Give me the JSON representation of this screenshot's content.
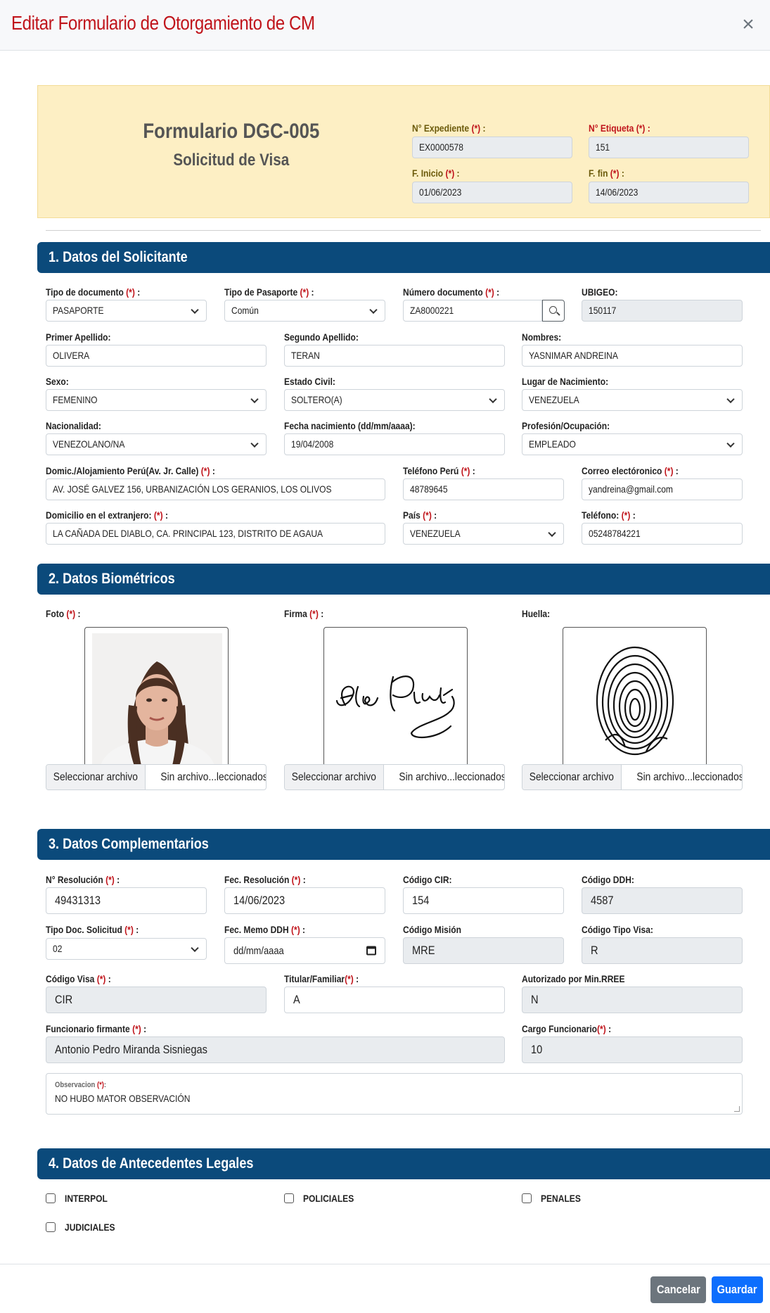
{
  "modal": {
    "title": "Editar Formulario de Otorgamiento de CM",
    "close_icon": "close-icon"
  },
  "header_box": {
    "title": "Formulario DGC-005",
    "subtitle": "Solicitud de Visa",
    "expediente_label": "N° Expediente",
    "expediente_value": "EX0000578",
    "etiqueta_label": "N° Etiqueta",
    "etiqueta_value": "151",
    "inicio_label": "F. Inicio",
    "inicio_value": "01/06/2023",
    "fin_label": "F. fin",
    "fin_value": "14/06/2023"
  },
  "req_mark": "(*)",
  "colon": ":",
  "section1": {
    "title": "1. Datos del Solicitante",
    "tipo_doc_label": "Tipo de documento",
    "tipo_doc_value": "PASAPORTE",
    "tipo_pas_label": "Tipo de Pasaporte",
    "tipo_pas_value": "Común",
    "num_doc_label": "Número documento",
    "num_doc_value": "ZA8000221",
    "ubigeo_label": "UBIGEO:",
    "ubigeo_value": "150117",
    "ap1_label": "Primer Apellido:",
    "ap1_value": "OLIVERA",
    "ap2_label": "Segundo Apellido:",
    "ap2_value": "TERAN",
    "nombres_label": "Nombres:",
    "nombres_value": "YASNIMAR ANDREINA",
    "sexo_label": "Sexo:",
    "sexo_value": "FEMENINO",
    "civil_label": "Estado Civil:",
    "civil_value": "SOLTERO(A)",
    "lugar_label": "Lugar de Nacimiento:",
    "lugar_value": "VENEZUELA",
    "nac_label": "Nacionalidad:",
    "nac_value": "VENEZOLANO/NA",
    "fnac_label": "Fecha nacimiento (dd/mm/aaaa):",
    "fnac_value": "19/04/2008",
    "prof_label": "Profesión/Ocupación:",
    "prof_value": "EMPLEADO",
    "domic_label": "Domic./Alojamiento Perú(Av. Jr. Calle)",
    "domic_value": "AV. JOSÉ GALVEZ 156, URBANIZACIÓN LOS GERANIOS, LOS OLIVOS",
    "tel_peru_label": "Teléfono Perú",
    "tel_peru_value": "48789645",
    "correo_label": "Correo electóronico",
    "correo_value": "yandreina@gmail.com",
    "domic_ext_label": "Domicilio en el extranjero:",
    "domic_ext_value": "LA CAÑADA DEL DIABLO, CA. PRINCIPAL 123, DISTRITO DE AGAUA",
    "pais_label": "País",
    "pais_value": "VENEZUELA",
    "tel_label": "Teléfono:",
    "tel_value": "05248784221"
  },
  "section2": {
    "title": "2. Datos Biométricos",
    "foto_label": "Foto",
    "firma_label": "Firma",
    "huella_label": "Huella:",
    "file_button": "Seleccionar archivo",
    "file_none": "Sin archivo...leccionados"
  },
  "section3": {
    "title": "3. Datos Complementarios",
    "resol_label": "N° Resolución",
    "resol_value": "49431313",
    "fresol_label": "Fec. Resolución",
    "fresol_value": "14/06/2023",
    "cir_label": "Código CIR:",
    "cir_value": "154",
    "ddh_label": "Código DDH:",
    "ddh_value": "4587",
    "tipodoc_label": "Tipo Doc. Solicitud",
    "tipodoc_value": "02",
    "memo_label": "Fec. Memo DDH",
    "memo_placeholder": "dd/mm/aaaa",
    "mision_label": "Código Misión",
    "mision_value": "MRE",
    "tipovisa_label": "Código Tipo Visa:",
    "tipovisa_value": "R",
    "visa_label": "Código Visa",
    "visa_value": "CIR",
    "titular_label": "Titular/Familiar",
    "titular_value": "A",
    "autorizado_label": "Autorizado por Min.RREE",
    "autorizado_value": "N",
    "funcionario_label": "Funcionario firmante",
    "funcionario_value": "Antonio Pedro Miranda Sisniegas",
    "cargo_label": "Cargo Funcionario",
    "cargo_value": "10",
    "obs_label": "Observacion",
    "obs_value": "NO HUBO MATOR OBSERVACIÓN"
  },
  "section4": {
    "title": "4. Datos de Antecedentes Legales",
    "interpol": "INTERPOL",
    "policiales": "POLICIALES",
    "penales": "PENALES",
    "judiciales": "JUDICIALES"
  },
  "footer": {
    "cancel": "Cancelar",
    "save": "Guardar"
  },
  "colors": {
    "accent": "#0b4a7b",
    "required": "#c0141b",
    "highlight_box": "#fdefc4",
    "save": "#0d6efd",
    "cancel": "#6c757d"
  }
}
